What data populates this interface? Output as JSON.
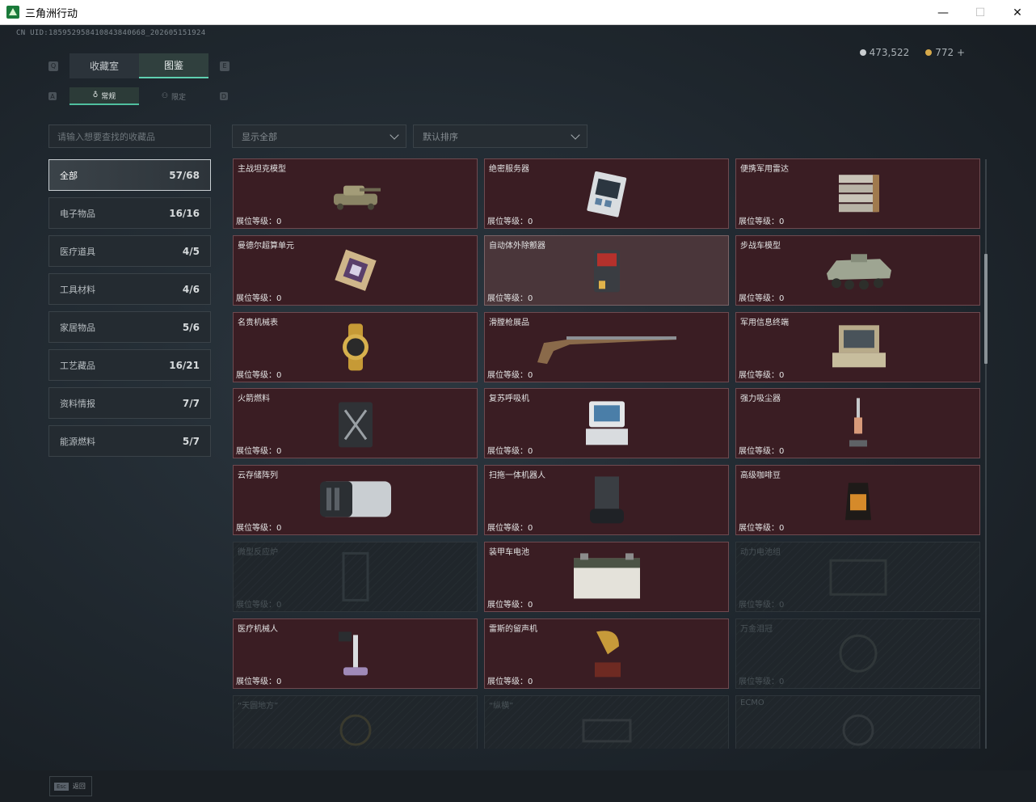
{
  "window": {
    "title": "三角洲行动",
    "minimize": "—",
    "maximize": "☐",
    "close": "✕"
  },
  "header": {
    "uid": "CN UID:18595295841084384066​8_202605151924",
    "currency": [
      {
        "icon": "silver-coin-icon",
        "value": "473,522"
      },
      {
        "icon": "gold-coin-icon",
        "value": "772 +"
      }
    ]
  },
  "tabs": [
    {
      "label": "收藏室",
      "active": false
    },
    {
      "label": "图鉴",
      "active": true
    }
  ],
  "subtabs": [
    {
      "label": "常规",
      "active": true
    },
    {
      "label": "限定",
      "active": false
    }
  ],
  "keycaps": {
    "left_tab": "Q",
    "right_tab": "E",
    "left_sub": "A",
    "right_sub": "D"
  },
  "search": {
    "placeholder": "请输入想要查找的收藏品"
  },
  "filters": {
    "display": "显示全部",
    "sort": "默认排序"
  },
  "categories": [
    {
      "label": "全部",
      "count": "57/68",
      "active": true
    },
    {
      "label": "电子物品",
      "count": "16/16",
      "active": false
    },
    {
      "label": "医疗道具",
      "count": "4/5",
      "active": false
    },
    {
      "label": "工具材料",
      "count": "4/6",
      "active": false
    },
    {
      "label": "家居物品",
      "count": "5/6",
      "active": false
    },
    {
      "label": "工艺藏品",
      "count": "16/21",
      "active": false
    },
    {
      "label": "资料情报",
      "count": "7/7",
      "active": false
    },
    {
      "label": "能源燃料",
      "count": "5/7",
      "active": false
    }
  ],
  "items": [
    {
      "name": "主战坦克模型",
      "level": "展位等级：0",
      "state": "owned",
      "icon": "tank-model-icon"
    },
    {
      "name": "绝密服务器",
      "level": "展位等级：0",
      "state": "owned",
      "icon": "server-icon"
    },
    {
      "name": "便携军用雷达",
      "level": "展位等级：0",
      "state": "owned",
      "icon": "radar-icon"
    },
    {
      "name": "曼德尔超算单元",
      "level": "展位等级：0",
      "state": "owned",
      "icon": "compute-unit-icon"
    },
    {
      "name": "自动体外除颤器",
      "level": "展位等级：0",
      "state": "highlighted",
      "icon": "defibrillator-icon"
    },
    {
      "name": "步战车模型",
      "level": "展位等级：0",
      "state": "owned",
      "icon": "ifv-model-icon"
    },
    {
      "name": "名贵机械表",
      "level": "展位等级：0",
      "state": "owned",
      "icon": "watch-icon"
    },
    {
      "name": "滑膛枪展品",
      "level": "展位等级：0",
      "state": "owned",
      "icon": "musket-icon"
    },
    {
      "name": "军用信息终端",
      "level": "展位等级：0",
      "state": "owned",
      "icon": "terminal-icon"
    },
    {
      "name": "火箭燃料",
      "level": "展位等级：0",
      "state": "owned",
      "icon": "fuel-can-icon"
    },
    {
      "name": "复苏呼吸机",
      "level": "展位等级：0",
      "state": "owned",
      "icon": "ventilator-icon"
    },
    {
      "name": "强力吸尘器",
      "level": "展位等级：0",
      "state": "owned",
      "icon": "vacuum-icon"
    },
    {
      "name": "云存储阵列",
      "level": "展位等级：0",
      "state": "owned",
      "icon": "storage-array-icon"
    },
    {
      "name": "扫拖一体机器人",
      "level": "展位等级：0",
      "state": "owned",
      "icon": "robot-vacuum-icon"
    },
    {
      "name": "高级咖啡豆",
      "level": "展位等级：0",
      "state": "owned",
      "icon": "coffee-bag-icon"
    },
    {
      "name": "微型反应炉",
      "level": "展位等级：0",
      "state": "locked",
      "icon": "reactor-icon"
    },
    {
      "name": "装甲车电池",
      "level": "展位等级：0",
      "state": "owned",
      "icon": "battery-icon"
    },
    {
      "name": "动力电池组",
      "level": "展位等级：0",
      "state": "locked",
      "icon": "power-pack-icon"
    },
    {
      "name": "医疗机械人",
      "level": "展位等级：0",
      "state": "owned",
      "icon": "medical-robot-icon"
    },
    {
      "name": "雷斯的留声机",
      "level": "展位等级：0",
      "state": "owned",
      "icon": "gramophone-icon"
    },
    {
      "name": "万金泪冠",
      "level": "展位等级：0",
      "state": "locked",
      "icon": "crown-icon"
    },
    {
      "name": "“天圆地方”",
      "level": "",
      "state": "locked",
      "icon": "globe-icon"
    },
    {
      "name": "“纵横”",
      "level": "",
      "state": "locked",
      "icon": "board-icon"
    },
    {
      "name": "ECMO",
      "level": "",
      "state": "locked",
      "icon": "ecmo-icon"
    }
  ],
  "footer": {
    "esc_key": "Esc",
    "esc_label": "返回"
  }
}
